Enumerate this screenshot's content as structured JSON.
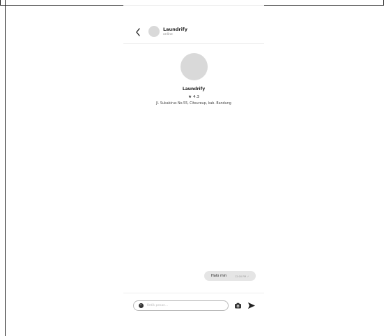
{
  "header": {
    "name": "Laundrify",
    "status": "online"
  },
  "profile": {
    "name": "Laundrify",
    "rating": "4.3",
    "address": "Jl. Sukabirus No.55, Citeureup, kab. Bandung"
  },
  "messages": [
    {
      "text": "Halo min",
      "time": "12:00 PM ✓"
    }
  ],
  "composer": {
    "placeholder": "Ketik pesan..."
  },
  "icons": {
    "back": "chevron-left-icon",
    "emoji": "emoji-icon",
    "camera": "camera-icon",
    "send": "send-icon"
  }
}
